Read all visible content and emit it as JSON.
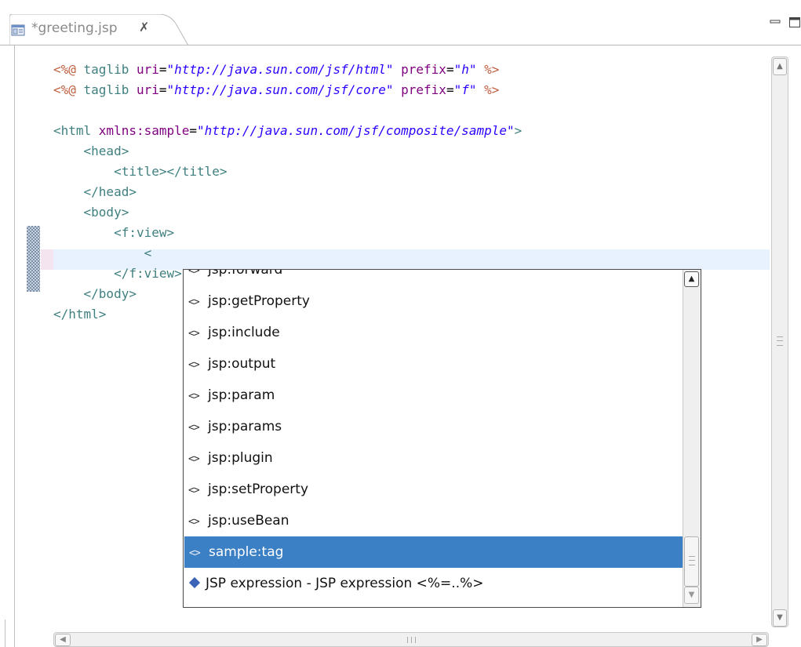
{
  "tab": {
    "title": "*greeting.jsp",
    "close_glyph": "✗",
    "icon": "jsp-file-icon"
  },
  "view_controls": {
    "minimize": "minimize-icon",
    "maximize": "maximize-icon"
  },
  "code": {
    "lines": [
      [
        {
          "t": "<%@",
          "c": "dir"
        },
        {
          "t": " taglib ",
          "c": "tag"
        },
        {
          "t": "uri",
          "c": "attr"
        },
        {
          "t": "=",
          "c": "eq"
        },
        {
          "t": "\"http://java.sun.com/jsf/html\"",
          "c": "val"
        },
        {
          "t": " ",
          "c": "tag"
        },
        {
          "t": "prefix",
          "c": "attr"
        },
        {
          "t": "=",
          "c": "eq"
        },
        {
          "t": "\"h\"",
          "c": "val"
        },
        {
          "t": " %>",
          "c": "dir"
        }
      ],
      [
        {
          "t": "<%@",
          "c": "dir"
        },
        {
          "t": " taglib ",
          "c": "tag"
        },
        {
          "t": "uri",
          "c": "attr"
        },
        {
          "t": "=",
          "c": "eq"
        },
        {
          "t": "\"http://java.sun.com/jsf/core\"",
          "c": "val"
        },
        {
          "t": " ",
          "c": "tag"
        },
        {
          "t": "prefix",
          "c": "attr"
        },
        {
          "t": "=",
          "c": "eq"
        },
        {
          "t": "\"f\"",
          "c": "val"
        },
        {
          "t": " %>",
          "c": "dir"
        }
      ],
      [],
      [
        {
          "t": "<html ",
          "c": "tag"
        },
        {
          "t": "xmlns:sample",
          "c": "attr"
        },
        {
          "t": "=",
          "c": "eq"
        },
        {
          "t": "\"http://java.sun.com/jsf/composite/sample\"",
          "c": "val"
        },
        {
          "t": ">",
          "c": "tag"
        }
      ],
      [
        {
          "t": "    <head>",
          "c": "tag"
        }
      ],
      [
        {
          "t": "        <title></title>",
          "c": "tag"
        }
      ],
      [
        {
          "t": "    </head>",
          "c": "tag"
        }
      ],
      [
        {
          "t": "    <body>",
          "c": "tag"
        }
      ],
      [
        {
          "t": "        <f:view>",
          "c": "tag"
        }
      ],
      [
        {
          "t": "            <",
          "c": "tag"
        }
      ],
      [
        {
          "t": "        </f:view>",
          "c": "tag"
        }
      ],
      [
        {
          "t": "    </body>",
          "c": "tag"
        }
      ],
      [
        {
          "t": "</html>",
          "c": "tag"
        }
      ]
    ]
  },
  "content_assist": {
    "items": [
      {
        "label": "jsp:forward",
        "icon": "tag-icon",
        "selected": false
      },
      {
        "label": "jsp:getProperty",
        "icon": "tag-icon",
        "selected": false
      },
      {
        "label": "jsp:include",
        "icon": "tag-icon",
        "selected": false
      },
      {
        "label": "jsp:output",
        "icon": "tag-icon",
        "selected": false
      },
      {
        "label": "jsp:param",
        "icon": "tag-icon",
        "selected": false
      },
      {
        "label": "jsp:params",
        "icon": "tag-icon",
        "selected": false
      },
      {
        "label": "jsp:plugin",
        "icon": "tag-icon",
        "selected": false
      },
      {
        "label": "jsp:setProperty",
        "icon": "tag-icon",
        "selected": false
      },
      {
        "label": "jsp:useBean",
        "icon": "tag-icon",
        "selected": false
      },
      {
        "label": "sample:tag",
        "icon": "tag-icon",
        "selected": true
      },
      {
        "label": "JSP expression - JSP expression <%=..%>",
        "icon": "template-icon",
        "selected": false
      }
    ],
    "tag_glyph": "<>",
    "selection_color": "#3b7fc4"
  },
  "colors": {
    "directive": "#bf5f3f",
    "attribute": "#7f007f",
    "value": "#2a00ff",
    "tag": "#3f7f7f",
    "current_line": "#e8f2fe"
  }
}
